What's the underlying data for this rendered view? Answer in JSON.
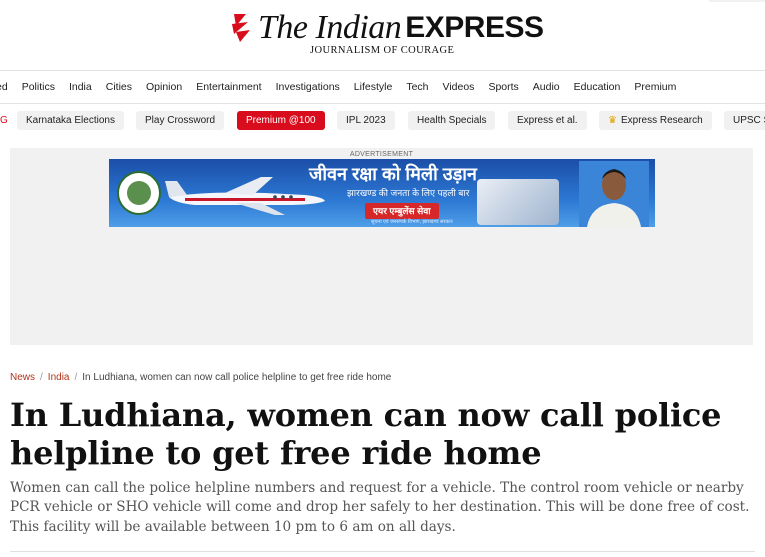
{
  "masthead": {
    "logo_the": "The Indian",
    "logo_express": "EXPRESS",
    "tagline": "JOURNALISM OF COURAGE"
  },
  "nav": {
    "items": [
      "ed",
      "Politics",
      "India",
      "Cities",
      "Opinion",
      "Entertainment",
      "Investigations",
      "Lifestyle",
      "Tech",
      "Videos",
      "Sports",
      "Audio",
      "Education",
      "Premium"
    ]
  },
  "chips": {
    "edge": "G",
    "items": [
      "Karnataka Elections",
      "Play Crossword",
      "Premium @100",
      "IPL 2023",
      "Health Specials",
      "Express et al.",
      "Express Research",
      "UPSC S"
    ]
  },
  "ad": {
    "label": "ADVERTISEMENT",
    "headline": "जीवन रक्षा को मिली उड़ान",
    "subline": "झारखण्ड की जनता के लिए पहली बार",
    "pill": "एयर एम्बुलेंस सेवा",
    "footnote": "सूचना एवं जनसंपर्क विभाग, झारखण्ड सरकार"
  },
  "breadcrumb": {
    "home": "News",
    "section": "India",
    "current": "In Ludhiana, women can now call police helpline to get free ride home",
    "separator": "/"
  },
  "article": {
    "headline": "In Ludhiana, women can now call police helpline to get free ride home",
    "summary": "Women can call the police helpline numbers and request for a vehicle. The control room vehicle or nearby PCR vehicle or SHO vehicle will come and drop her safely to her destination. This will be done free of cost. This facility will be available between 10 pm to 6 am on all days."
  },
  "colors": {
    "brand_red": "#d90c1d",
    "breadcrumb_link": "#b2341a",
    "ad_background": "#f1f1f1"
  }
}
